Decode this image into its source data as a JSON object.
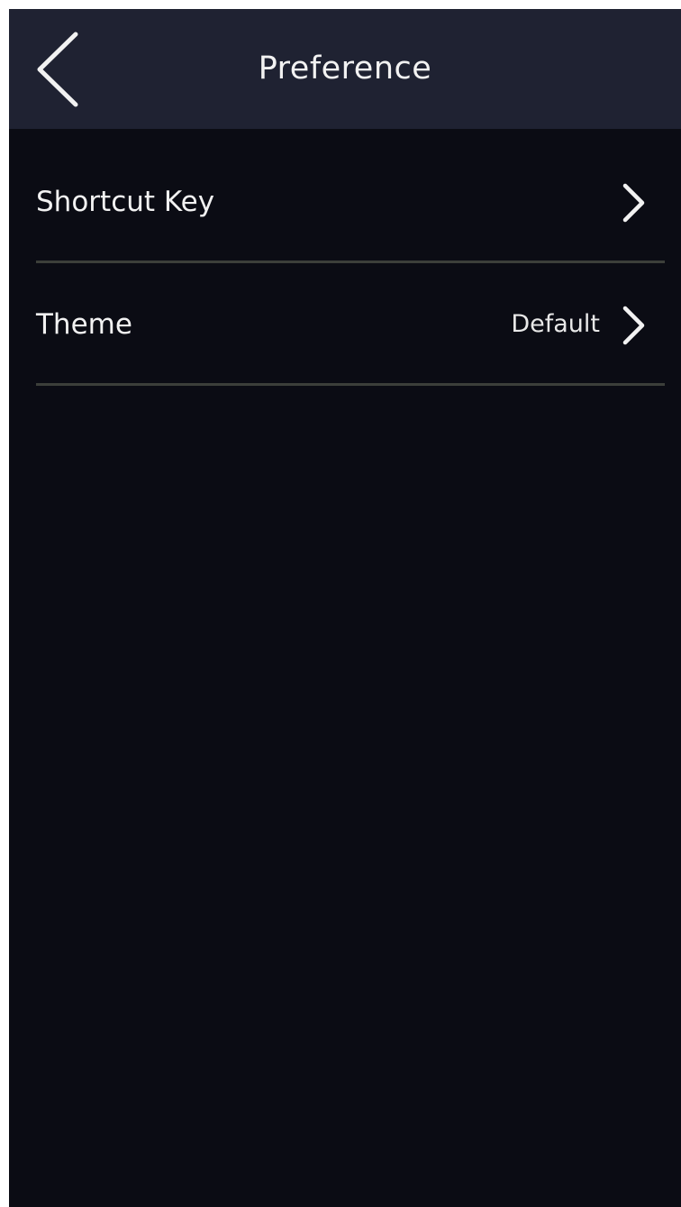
{
  "header": {
    "title": "Preference",
    "back_icon": "chevron-left-icon"
  },
  "items": [
    {
      "label": "Shortcut Key",
      "value": "",
      "icon": "chevron-right-icon"
    },
    {
      "label": "Theme",
      "value": "Default",
      "icon": "chevron-right-icon"
    }
  ],
  "colors": {
    "background": "#0b0c14",
    "header_background": "#1f2232",
    "text": "#f2f2f2",
    "divider": "#3c3f3a"
  }
}
